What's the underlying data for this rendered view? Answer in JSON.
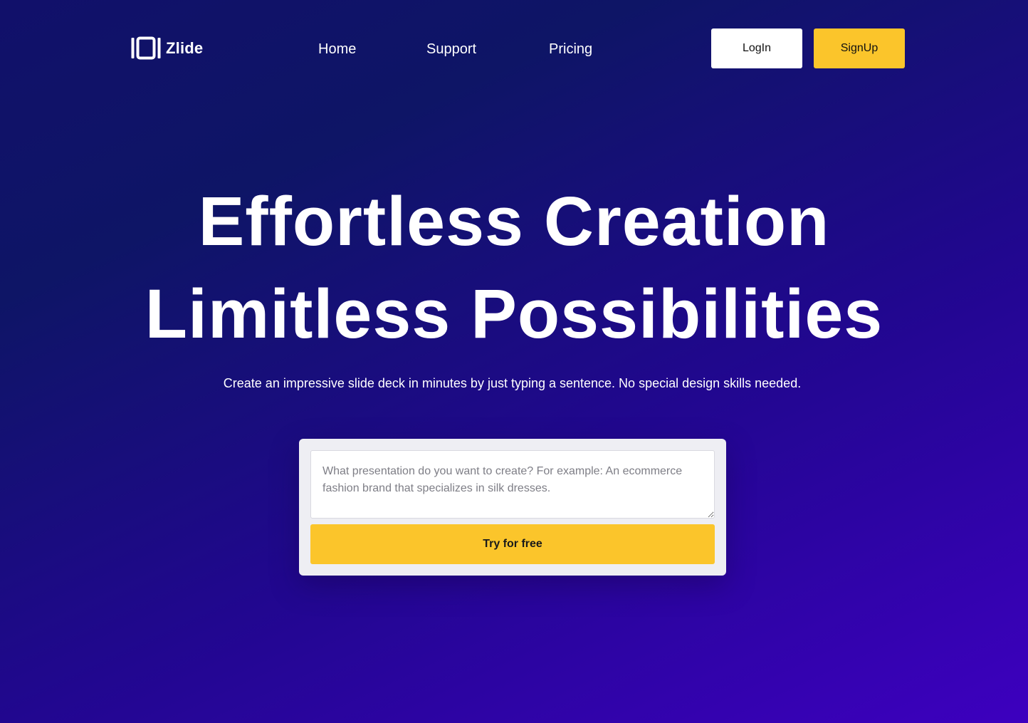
{
  "header": {
    "logo": {
      "icon": "slides-frame-icon",
      "text": "Zlide"
    },
    "nav": [
      {
        "label": "Home"
      },
      {
        "label": "Support"
      },
      {
        "label": "Pricing"
      }
    ],
    "login_label": "LogIn",
    "signup_label": "SignUp"
  },
  "hero": {
    "title_line1": "Effortless Creation",
    "title_line2": "Limitless Possibilities",
    "subtitle": "Create an impressive slide deck in minutes by just typing a sentence. No special design skills needed."
  },
  "prompt": {
    "value": "",
    "placeholder": "What presentation do you want to create? For example: An ecommerce fashion brand that specializes in silk dresses.",
    "button_label": "Try for free"
  },
  "colors": {
    "background_start": "#11106a",
    "background_end": "#3d00bf",
    "accent": "#fbc52b",
    "card": "#eeeef3"
  }
}
